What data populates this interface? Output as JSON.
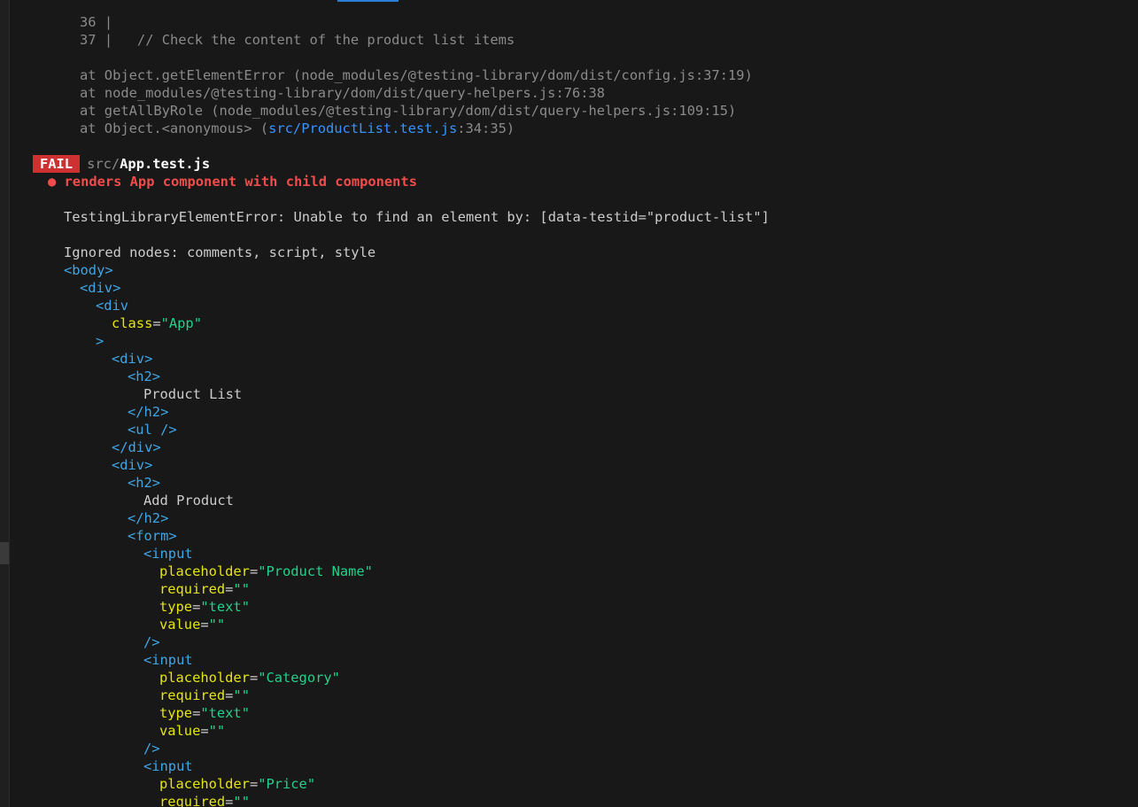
{
  "code_frame": {
    "line36_num": "36",
    "line36_sep": "|",
    "line37_num": "37",
    "line37_sep": "|",
    "line37_code": "// Check the content of the product list items"
  },
  "stack": [
    {
      "prefix": "at Object.getElementError (",
      "path": "node_modules/@testing-library/dom/dist/config.js",
      "loc": ":37:19",
      "suffix": ")"
    },
    {
      "prefix": "at ",
      "path": "node_modules/@testing-library/dom/dist/query-helpers.js",
      "loc": ":76:38",
      "suffix": ""
    },
    {
      "prefix": "at getAllByRole (",
      "path": "node_modules/@testing-library/dom/dist/query-helpers.js",
      "loc": ":109:15",
      "suffix": ")"
    },
    {
      "prefix": "at Object.<anonymous> (",
      "path": "src/ProductList.test.js",
      "loc": ":34:35",
      "suffix": ")"
    }
  ],
  "fail": {
    "badge": "FAIL",
    "dir": "src/",
    "file": "App.test.js",
    "test_name": "● renders App component with child components"
  },
  "error": {
    "message": "TestingLibraryElementError: Unable to find an element by: [data-testid=\"product-list\"]",
    "ignored": "Ignored nodes: comments, script, style"
  },
  "dom": {
    "body_open": "<body>",
    "div_open": "<div>",
    "div_partial": "<div",
    "class_attr": "class",
    "class_val": "\"App\"",
    "gt": ">",
    "h2_open": "<h2>",
    "h2_close": "</h2>",
    "heading1": "Product List",
    "ul_self": "<ul />",
    "div_close": "</div>",
    "heading2": "Add Product",
    "form_open": "<form>",
    "input_open": "<input",
    "self_close": "/>",
    "placeholder_attr": "placeholder",
    "required_attr": "required",
    "type_attr": "type",
    "value_attr": "value",
    "eq": "=",
    "empty_str": "\"\"",
    "text_val": "\"text\"",
    "ph_product_name": "\"Product Name\"",
    "ph_category": "\"Category\"",
    "ph_price": "\"Price\""
  }
}
